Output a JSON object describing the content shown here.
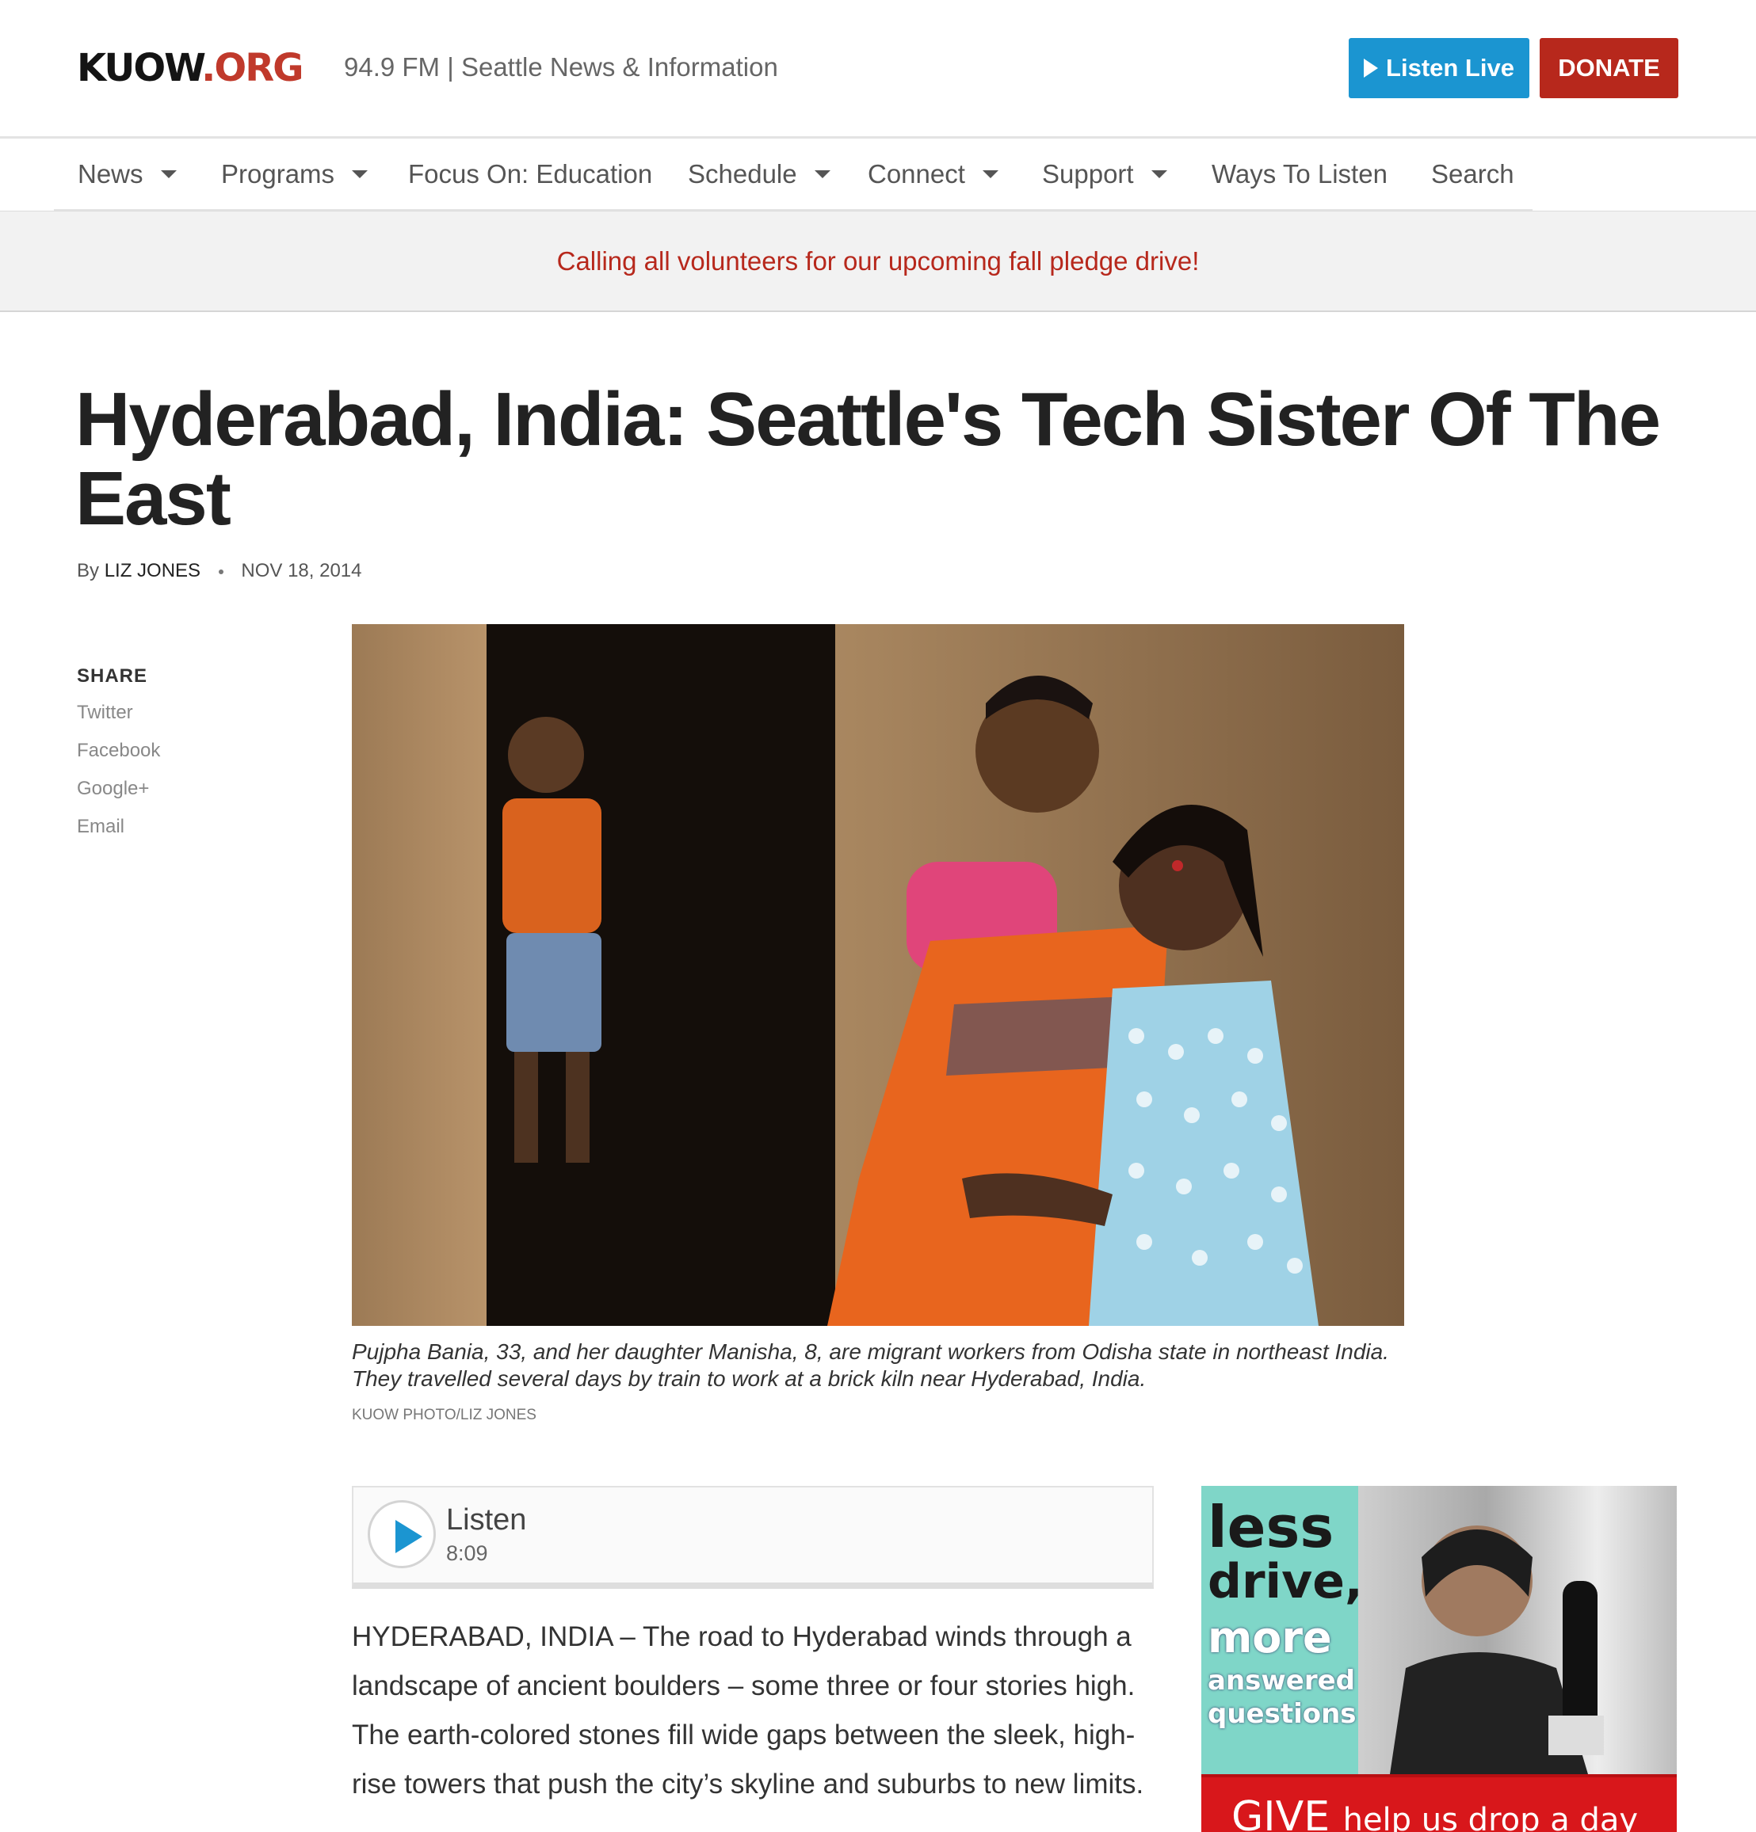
{
  "header": {
    "logo": {
      "main": "KUOW",
      "suffix": ".ORG"
    },
    "tagline": "94.9 FM | Seattle News & Information",
    "listen_live": "Listen Live",
    "donate": "DONATE"
  },
  "nav": {
    "items": [
      {
        "label": "News",
        "dropdown": true
      },
      {
        "label": "Programs",
        "dropdown": true
      },
      {
        "label": "Focus On: Education",
        "dropdown": false
      },
      {
        "label": "Schedule",
        "dropdown": true
      },
      {
        "label": "Connect",
        "dropdown": true
      },
      {
        "label": "Support",
        "dropdown": true
      },
      {
        "label": "Ways To Listen",
        "dropdown": false
      },
      {
        "label": "Search",
        "dropdown": false
      }
    ]
  },
  "banner": {
    "text": "Calling all volunteers for our upcoming fall pledge drive!"
  },
  "article": {
    "headline": "Hyderabad, India: Seattle's Tech Sister Of The East",
    "byline_prefix": "By",
    "author": "Liz Jones",
    "date": "Nov 18, 2014",
    "caption": "Pujpha Bania, 33, and her daughter Manisha, 8, are migrant workers from Odisha state in northeast India. They travelled several days by train to work at a brick kiln near Hyderabad, India.",
    "photo_credit": "KUOW Photo/Liz Jones",
    "body": "HYDERABAD, INDIA – The road to Hyderabad winds through a landscape of ancient boulders – some three or four stories high. The earth-colored stones fill wide gaps between the sleek, high-rise towers that push the city’s skyline and suburbs to new limits."
  },
  "share": {
    "title": "SHARE",
    "links": [
      "Twitter",
      "Facebook",
      "Google+",
      "Email"
    ]
  },
  "player": {
    "label": "Listen",
    "duration": "8:09"
  },
  "ad": {
    "line1": "less",
    "line2": "drive,",
    "line3": "more",
    "line4": "answered",
    "line5": "questions",
    "give": "GIVE",
    "give_tail": "help us drop a day"
  },
  "colors": {
    "accent_blue": "#1b95d1",
    "brand_red": "#b7281c",
    "banner_link": "#b7281c"
  }
}
